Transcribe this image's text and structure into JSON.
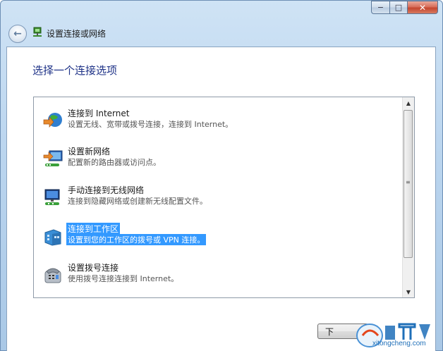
{
  "window": {
    "title": "设置连接或网络",
    "caption": {
      "minimize": "−",
      "maximize": "□",
      "close": "✕"
    }
  },
  "page": {
    "heading": "选择一个连接选项"
  },
  "options": [
    {
      "label": "连接到 Internet",
      "desc": "设置无线、宽带或拨号连接，连接到 Internet。",
      "icon": "globe-internet-icon",
      "selected": false
    },
    {
      "label": "设置新网络",
      "desc": "配置新的路由器或访问点。",
      "icon": "new-network-icon",
      "selected": false
    },
    {
      "label": "手动连接到无线网络",
      "desc": "连接到隐藏网络或创建新无线配置文件。",
      "icon": "wireless-network-icon",
      "selected": false
    },
    {
      "label": "连接到工作区",
      "desc": "设置到您的工作区的拨号或 VPN 连接。",
      "icon": "workplace-vpn-icon",
      "selected": true
    },
    {
      "label": "设置拨号连接",
      "desc": "使用拨号连接连接到 Internet。",
      "icon": "dialup-phone-icon",
      "selected": false
    }
  ],
  "buttons": {
    "next": "下"
  },
  "watermark": {
    "text": "xitongcheng.com"
  },
  "colors": {
    "accent": "#3399ff",
    "heading": "#1e3287"
  }
}
